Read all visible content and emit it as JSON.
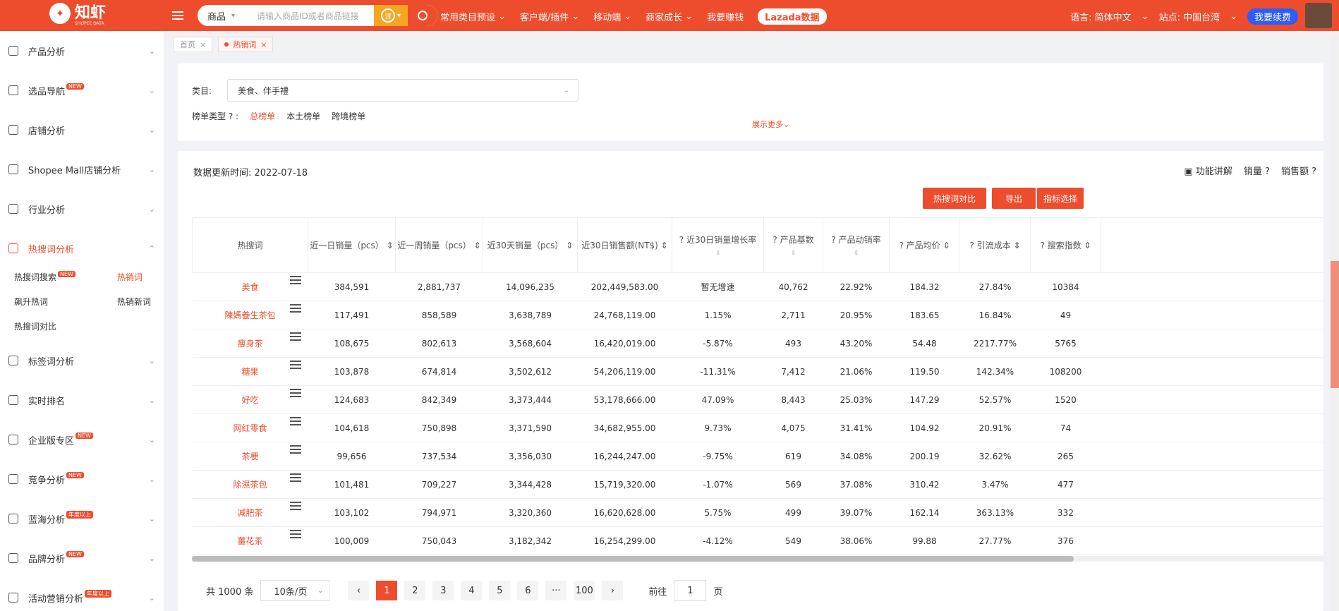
{
  "header": {
    "logo_text": "知虾",
    "logo_sub": "SHOPEE DATA",
    "search_category": "商品",
    "search_placeholder": "请输入商品ID或者商品链接",
    "translate_icon": "译",
    "nav": [
      "常用类目预设",
      "客户端/插件",
      "移动端",
      "商家成长",
      "我要赚钱"
    ],
    "lazada": "Lazada数据",
    "language": "语言: 简体中文",
    "site": "站点: 中国台湾",
    "renew": "我要续费"
  },
  "sidebar": {
    "items": [
      {
        "label": "产品分析",
        "badge": ""
      },
      {
        "label": "选品导航",
        "badge": "NEW"
      },
      {
        "label": "店铺分析",
        "badge": ""
      },
      {
        "label": "Shopee Mall店铺分析",
        "badge": ""
      },
      {
        "label": "行业分析",
        "badge": ""
      },
      {
        "label": "热搜词分析",
        "badge": ""
      }
    ],
    "sub": [
      {
        "label": "热搜词搜索",
        "badge": "NEW"
      },
      {
        "label": "热销词",
        "badge": ""
      },
      {
        "label": "飙升热词",
        "badge": ""
      },
      {
        "label": "热销新词",
        "badge": ""
      },
      {
        "label": "热搜词对比",
        "badge": ""
      }
    ],
    "items2": [
      {
        "label": "标签词分析",
        "badge": ""
      },
      {
        "label": "实时排名",
        "badge": ""
      },
      {
        "label": "企业版专区",
        "badge": "NEW"
      },
      {
        "label": "竞争分析",
        "badge": "NEW"
      },
      {
        "label": "蓝海分析",
        "badge": "年度以上"
      },
      {
        "label": "品牌分析",
        "badge": "NEW"
      },
      {
        "label": "活动营销分析",
        "badge": "年度以上"
      }
    ]
  },
  "tabs": [
    {
      "label": "首页",
      "close": "×"
    },
    {
      "label": "热销词",
      "close": "×"
    }
  ],
  "filter": {
    "category_label": "类目:",
    "category_value": "美食、伴手禮",
    "rank_type_label": "榜单类型",
    "rank_types": [
      "总榜单",
      "本土榜单",
      "跨境榜单"
    ],
    "show_more": "展示更多"
  },
  "main": {
    "update_label": "数据更新时间: 2022-07-18",
    "tools": [
      "功能讲解",
      "销量",
      "销售额"
    ],
    "buttons": [
      "热搜词对比",
      "导出",
      "指标选择"
    ],
    "columns": [
      "热搜词",
      "近一日销量（pcs）",
      "近一周销量（pcs）",
      "近30天销量（pcs）",
      "近30日销售额(NT$)",
      "近30日销量增长率",
      "产品基数",
      "产品动销率",
      "产品均价",
      "引流成本",
      "搜索指数"
    ],
    "rows": [
      [
        "美食",
        "384,591",
        "2,881,737",
        "14,096,235",
        "202,449,583.00",
        "暂无增速",
        "40,762",
        "22.92%",
        "184.32",
        "27.84%",
        "10384"
      ],
      [
        "陳媽養生茶包",
        "117,491",
        "858,589",
        "3,638,789",
        "24,768,119.00",
        "1.15%",
        "2,711",
        "20.95%",
        "183.65",
        "16.84%",
        "49"
      ],
      [
        "瘦身茶",
        "108,675",
        "802,613",
        "3,568,604",
        "16,420,019.00",
        "-5.87%",
        "493",
        "43.20%",
        "54.48",
        "2217.77%",
        "5765"
      ],
      [
        "糖果",
        "103,878",
        "674,814",
        "3,502,612",
        "54,206,119.00",
        "-11.31%",
        "7,412",
        "21.06%",
        "119.50",
        "142.34%",
        "108200"
      ],
      [
        "好吃",
        "124,683",
        "842,349",
        "3,373,444",
        "53,178,666.00",
        "47.09%",
        "8,443",
        "25.03%",
        "147.29",
        "52.57%",
        "1520"
      ],
      [
        "网红零食",
        "104,618",
        "750,898",
        "3,371,590",
        "34,682,955.00",
        "9.73%",
        "4,075",
        "31.41%",
        "104.92",
        "20.91%",
        "74"
      ],
      [
        "茶梗",
        "99,656",
        "737,534",
        "3,356,030",
        "16,244,247.00",
        "-9.75%",
        "619",
        "34.08%",
        "200.19",
        "32.62%",
        "265"
      ],
      [
        "除濕茶包",
        "101,481",
        "709,227",
        "3,344,428",
        "15,719,320.00",
        "-1.07%",
        "569",
        "37.08%",
        "310.42",
        "3.47%",
        "477"
      ],
      [
        "减肥茶",
        "103,102",
        "794,971",
        "3,320,360",
        "16,620,628.00",
        "5.75%",
        "499",
        "39.07%",
        "162.14",
        "363.13%",
        "332"
      ],
      [
        "薑花茶",
        "100,009",
        "750,043",
        "3,182,342",
        "16,254,299.00",
        "-4.12%",
        "549",
        "38.06%",
        "99.88",
        "27.77%",
        "376"
      ]
    ]
  },
  "pager": {
    "total": "共 1000 条",
    "per_page": "10条/页",
    "pages": [
      "1",
      "2",
      "3",
      "4",
      "5",
      "6",
      "···",
      "100"
    ],
    "prev": "‹",
    "next": "›",
    "goto": "前往",
    "goto_value": "1",
    "page_unit": "页"
  }
}
